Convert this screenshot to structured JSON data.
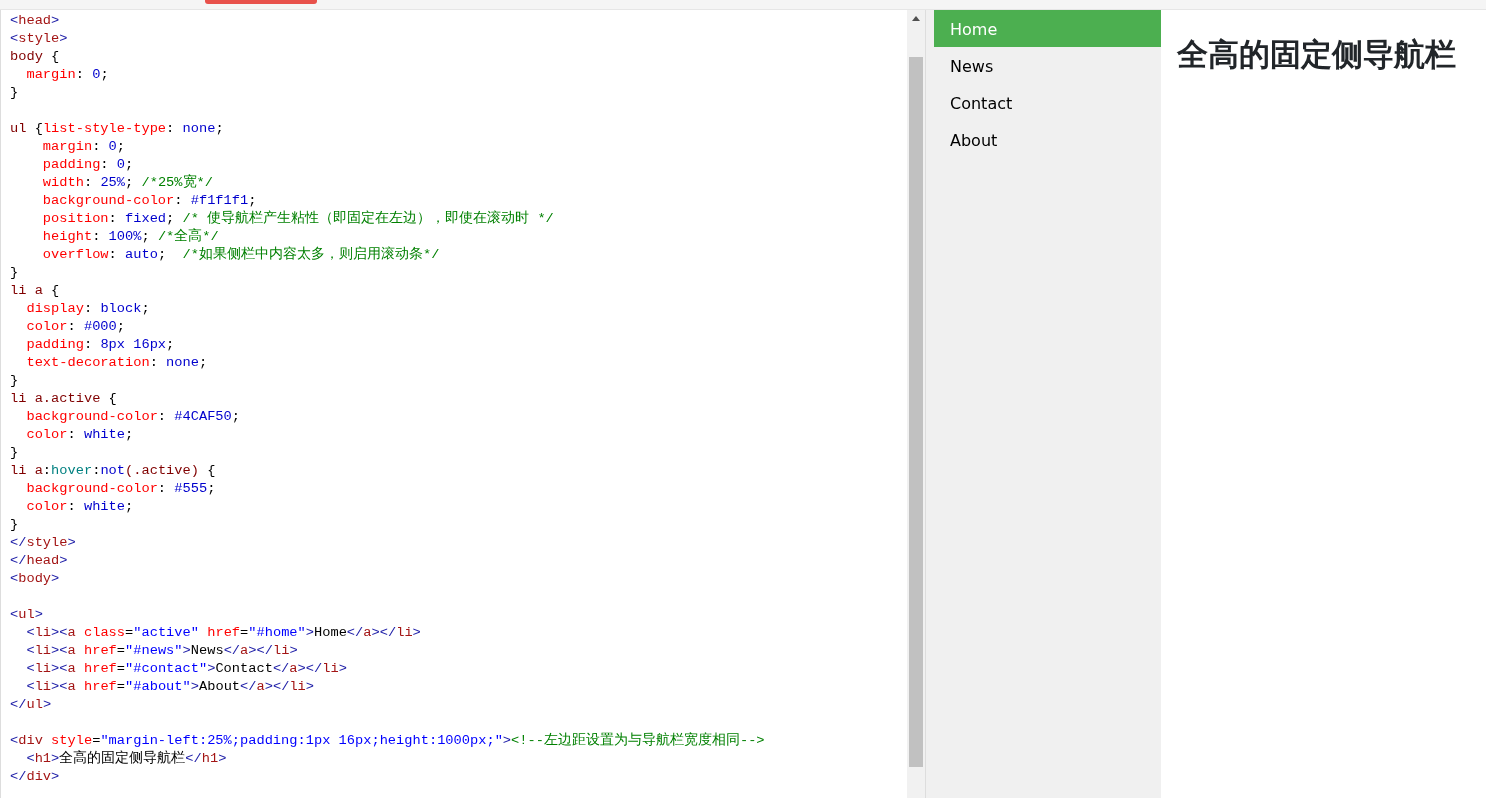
{
  "editor": {
    "blocks": [
      {
        "lines": [
          [
            {
              "kind": "punct",
              "text": "<"
            },
            {
              "kind": "tag",
              "text": "head"
            },
            {
              "kind": "punct",
              "text": ">"
            }
          ],
          [
            {
              "kind": "punct",
              "text": "<"
            },
            {
              "kind": "tag",
              "text": "style"
            },
            {
              "kind": "punct",
              "text": ">"
            }
          ],
          [
            {
              "kind": "selector",
              "text": "body "
            },
            {
              "kind": "text",
              "text": "{"
            }
          ],
          [
            {
              "kind": "property",
              "text": "  margin"
            },
            {
              "kind": "text",
              "text": ": "
            },
            {
              "kind": "value",
              "text": "0"
            },
            {
              "kind": "text",
              "text": ";"
            }
          ],
          [
            {
              "kind": "text",
              "text": "}"
            }
          ]
        ]
      },
      {
        "lines": [
          [
            {
              "kind": "selector",
              "text": "ul "
            },
            {
              "kind": "text",
              "text": "{"
            },
            {
              "kind": "property",
              "text": "list-style-type"
            },
            {
              "kind": "text",
              "text": ": "
            },
            {
              "kind": "value",
              "text": "none"
            },
            {
              "kind": "text",
              "text": ";"
            }
          ],
          [
            {
              "kind": "property",
              "text": "    margin"
            },
            {
              "kind": "text",
              "text": ": "
            },
            {
              "kind": "value",
              "text": "0"
            },
            {
              "kind": "text",
              "text": ";"
            }
          ],
          [
            {
              "kind": "property",
              "text": "    padding"
            },
            {
              "kind": "text",
              "text": ": "
            },
            {
              "kind": "value",
              "text": "0"
            },
            {
              "kind": "text",
              "text": ";"
            }
          ],
          [
            {
              "kind": "property",
              "text": "    width"
            },
            {
              "kind": "text",
              "text": ": "
            },
            {
              "kind": "value",
              "text": "25%"
            },
            {
              "kind": "text",
              "text": "; "
            },
            {
              "kind": "comment",
              "text": "/*25%宽*/"
            }
          ],
          [
            {
              "kind": "property",
              "text": "    background-color"
            },
            {
              "kind": "text",
              "text": ": "
            },
            {
              "kind": "value",
              "text": "#f1f1f1"
            },
            {
              "kind": "text",
              "text": ";"
            }
          ],
          [
            {
              "kind": "property",
              "text": "    position"
            },
            {
              "kind": "text",
              "text": ": "
            },
            {
              "kind": "value",
              "text": "fixed"
            },
            {
              "kind": "text",
              "text": "; "
            },
            {
              "kind": "comment",
              "text": "/* 使导航栏产生粘性（即固定在左边），即使在滚动时 */"
            }
          ],
          [
            {
              "kind": "property",
              "text": "    height"
            },
            {
              "kind": "text",
              "text": ": "
            },
            {
              "kind": "value",
              "text": "100%"
            },
            {
              "kind": "text",
              "text": "; "
            },
            {
              "kind": "comment",
              "text": "/*全高*/"
            }
          ],
          [
            {
              "kind": "property",
              "text": "    overflow"
            },
            {
              "kind": "text",
              "text": ": "
            },
            {
              "kind": "value",
              "text": "auto"
            },
            {
              "kind": "text",
              "text": ";"
            },
            {
              "kind": "comment",
              "text": "  /*如果侧栏中内容太多，则启用滚动条*/"
            }
          ],
          [
            {
              "kind": "text",
              "text": "}"
            }
          ],
          [
            {
              "kind": "selector",
              "text": "li a "
            },
            {
              "kind": "text",
              "text": "{"
            }
          ],
          [
            {
              "kind": "property",
              "text": "  display"
            },
            {
              "kind": "text",
              "text": ": "
            },
            {
              "kind": "value",
              "text": "block"
            },
            {
              "kind": "text",
              "text": ";"
            }
          ],
          [
            {
              "kind": "property",
              "text": "  color"
            },
            {
              "kind": "text",
              "text": ": "
            },
            {
              "kind": "value",
              "text": "#000"
            },
            {
              "kind": "text",
              "text": ";"
            }
          ],
          [
            {
              "kind": "property",
              "text": "  padding"
            },
            {
              "kind": "text",
              "text": ": "
            },
            {
              "kind": "value",
              "text": "8px 16px"
            },
            {
              "kind": "text",
              "text": ";"
            }
          ],
          [
            {
              "kind": "property",
              "text": "  text-decoration"
            },
            {
              "kind": "text",
              "text": ": "
            },
            {
              "kind": "value",
              "text": "none"
            },
            {
              "kind": "text",
              "text": ";"
            }
          ],
          [
            {
              "kind": "text",
              "text": "}"
            }
          ],
          [
            {
              "kind": "selector",
              "text": "li a.active "
            },
            {
              "kind": "text",
              "text": "{"
            }
          ],
          [
            {
              "kind": "property",
              "text": "  background-color"
            },
            {
              "kind": "text",
              "text": ": "
            },
            {
              "kind": "value",
              "text": "#4CAF50"
            },
            {
              "kind": "text",
              "text": ";"
            }
          ],
          [
            {
              "kind": "property",
              "text": "  color"
            },
            {
              "kind": "text",
              "text": ": "
            },
            {
              "kind": "value",
              "text": "white"
            },
            {
              "kind": "text",
              "text": ";"
            }
          ],
          [
            {
              "kind": "text",
              "text": "}"
            }
          ],
          [
            {
              "kind": "selector",
              "text": "li a"
            },
            {
              "kind": "text",
              "text": ":"
            },
            {
              "kind": "pseudo",
              "text": "hover"
            },
            {
              "kind": "text",
              "text": ":"
            },
            {
              "kind": "value",
              "text": "not"
            },
            {
              "kind": "selector",
              "text": "(.active) "
            },
            {
              "kind": "text",
              "text": "{"
            }
          ],
          [
            {
              "kind": "property",
              "text": "  background-color"
            },
            {
              "kind": "text",
              "text": ": "
            },
            {
              "kind": "value",
              "text": "#555"
            },
            {
              "kind": "text",
              "text": ";"
            }
          ],
          [
            {
              "kind": "property",
              "text": "  color"
            },
            {
              "kind": "text",
              "text": ": "
            },
            {
              "kind": "value",
              "text": "white"
            },
            {
              "kind": "text",
              "text": ";"
            }
          ],
          [
            {
              "kind": "text",
              "text": "}"
            }
          ],
          [
            {
              "kind": "punct",
              "text": "</"
            },
            {
              "kind": "tag",
              "text": "style"
            },
            {
              "kind": "punct",
              "text": ">"
            }
          ],
          [
            {
              "kind": "punct",
              "text": "</"
            },
            {
              "kind": "tag",
              "text": "head"
            },
            {
              "kind": "punct",
              "text": ">"
            }
          ],
          [
            {
              "kind": "punct",
              "text": "<"
            },
            {
              "kind": "tag",
              "text": "body"
            },
            {
              "kind": "punct",
              "text": ">"
            }
          ]
        ]
      },
      {
        "lines": [
          [
            {
              "kind": "punct",
              "text": "<"
            },
            {
              "kind": "tag",
              "text": "ul"
            },
            {
              "kind": "punct",
              "text": ">"
            }
          ],
          [
            {
              "kind": "punct",
              "text": "  <"
            },
            {
              "kind": "tag",
              "text": "li"
            },
            {
              "kind": "punct",
              "text": "><"
            },
            {
              "kind": "tag",
              "text": "a "
            },
            {
              "kind": "attr",
              "text": "class"
            },
            {
              "kind": "text",
              "text": "="
            },
            {
              "kind": "string",
              "text": "\"active\" "
            },
            {
              "kind": "attr",
              "text": "href"
            },
            {
              "kind": "text",
              "text": "="
            },
            {
              "kind": "string",
              "text": "\"#home\""
            },
            {
              "kind": "punct",
              "text": ">"
            },
            {
              "kind": "text",
              "text": "Home"
            },
            {
              "kind": "punct",
              "text": "</"
            },
            {
              "kind": "tag",
              "text": "a"
            },
            {
              "kind": "punct",
              "text": "></"
            },
            {
              "kind": "tag",
              "text": "li"
            },
            {
              "kind": "punct",
              "text": ">"
            }
          ],
          [
            {
              "kind": "punct",
              "text": "  <"
            },
            {
              "kind": "tag",
              "text": "li"
            },
            {
              "kind": "punct",
              "text": "><"
            },
            {
              "kind": "tag",
              "text": "a "
            },
            {
              "kind": "attr",
              "text": "href"
            },
            {
              "kind": "text",
              "text": "="
            },
            {
              "kind": "string",
              "text": "\"#news\""
            },
            {
              "kind": "punct",
              "text": ">"
            },
            {
              "kind": "text",
              "text": "News"
            },
            {
              "kind": "punct",
              "text": "</"
            },
            {
              "kind": "tag",
              "text": "a"
            },
            {
              "kind": "punct",
              "text": "></"
            },
            {
              "kind": "tag",
              "text": "li"
            },
            {
              "kind": "punct",
              "text": ">"
            }
          ],
          [
            {
              "kind": "punct",
              "text": "  <"
            },
            {
              "kind": "tag",
              "text": "li"
            },
            {
              "kind": "punct",
              "text": "><"
            },
            {
              "kind": "tag",
              "text": "a "
            },
            {
              "kind": "attr",
              "text": "href"
            },
            {
              "kind": "text",
              "text": "="
            },
            {
              "kind": "string",
              "text": "\"#contact\""
            },
            {
              "kind": "punct",
              "text": ">"
            },
            {
              "kind": "text",
              "text": "Contact"
            },
            {
              "kind": "punct",
              "text": "</"
            },
            {
              "kind": "tag",
              "text": "a"
            },
            {
              "kind": "punct",
              "text": "></"
            },
            {
              "kind": "tag",
              "text": "li"
            },
            {
              "kind": "punct",
              "text": ">"
            }
          ],
          [
            {
              "kind": "punct",
              "text": "  <"
            },
            {
              "kind": "tag",
              "text": "li"
            },
            {
              "kind": "punct",
              "text": "><"
            },
            {
              "kind": "tag",
              "text": "a "
            },
            {
              "kind": "attr",
              "text": "href"
            },
            {
              "kind": "text",
              "text": "="
            },
            {
              "kind": "string",
              "text": "\"#about\""
            },
            {
              "kind": "punct",
              "text": ">"
            },
            {
              "kind": "text",
              "text": "About"
            },
            {
              "kind": "punct",
              "text": "</"
            },
            {
              "kind": "tag",
              "text": "a"
            },
            {
              "kind": "punct",
              "text": "></"
            },
            {
              "kind": "tag",
              "text": "li"
            },
            {
              "kind": "punct",
              "text": ">"
            }
          ],
          [
            {
              "kind": "punct",
              "text": "</"
            },
            {
              "kind": "tag",
              "text": "ul"
            },
            {
              "kind": "punct",
              "text": ">"
            }
          ]
        ]
      },
      {
        "lines": [
          [
            {
              "kind": "punct",
              "text": "<"
            },
            {
              "kind": "tag",
              "text": "div "
            },
            {
              "kind": "attr",
              "text": "style"
            },
            {
              "kind": "text",
              "text": "="
            },
            {
              "kind": "string",
              "text": "\"margin-left:25%;padding:1px 16px;height:1000px;\""
            },
            {
              "kind": "punct",
              "text": ">"
            },
            {
              "kind": "comment",
              "text": "<!--左边距设置为与导航栏宽度相同-->"
            }
          ],
          [
            {
              "kind": "punct",
              "text": "  <"
            },
            {
              "kind": "tag",
              "text": "h1"
            },
            {
              "kind": "punct",
              "text": ">"
            },
            {
              "kind": "text",
              "text": "全高的固定侧导航栏"
            },
            {
              "kind": "punct",
              "text": "</"
            },
            {
              "kind": "tag",
              "text": "h1"
            },
            {
              "kind": "punct",
              "text": ">"
            }
          ],
          [
            {
              "kind": "punct",
              "text": "</"
            },
            {
              "kind": "tag",
              "text": "div"
            },
            {
              "kind": "punct",
              "text": ">"
            }
          ]
        ]
      }
    ]
  },
  "preview": {
    "nav": [
      {
        "label": "Home",
        "selected": true
      },
      {
        "label": "News",
        "selected": false
      },
      {
        "label": "Contact",
        "selected": false
      },
      {
        "label": "About",
        "selected": false
      }
    ],
    "heading": "全高的固定侧导航栏"
  }
}
